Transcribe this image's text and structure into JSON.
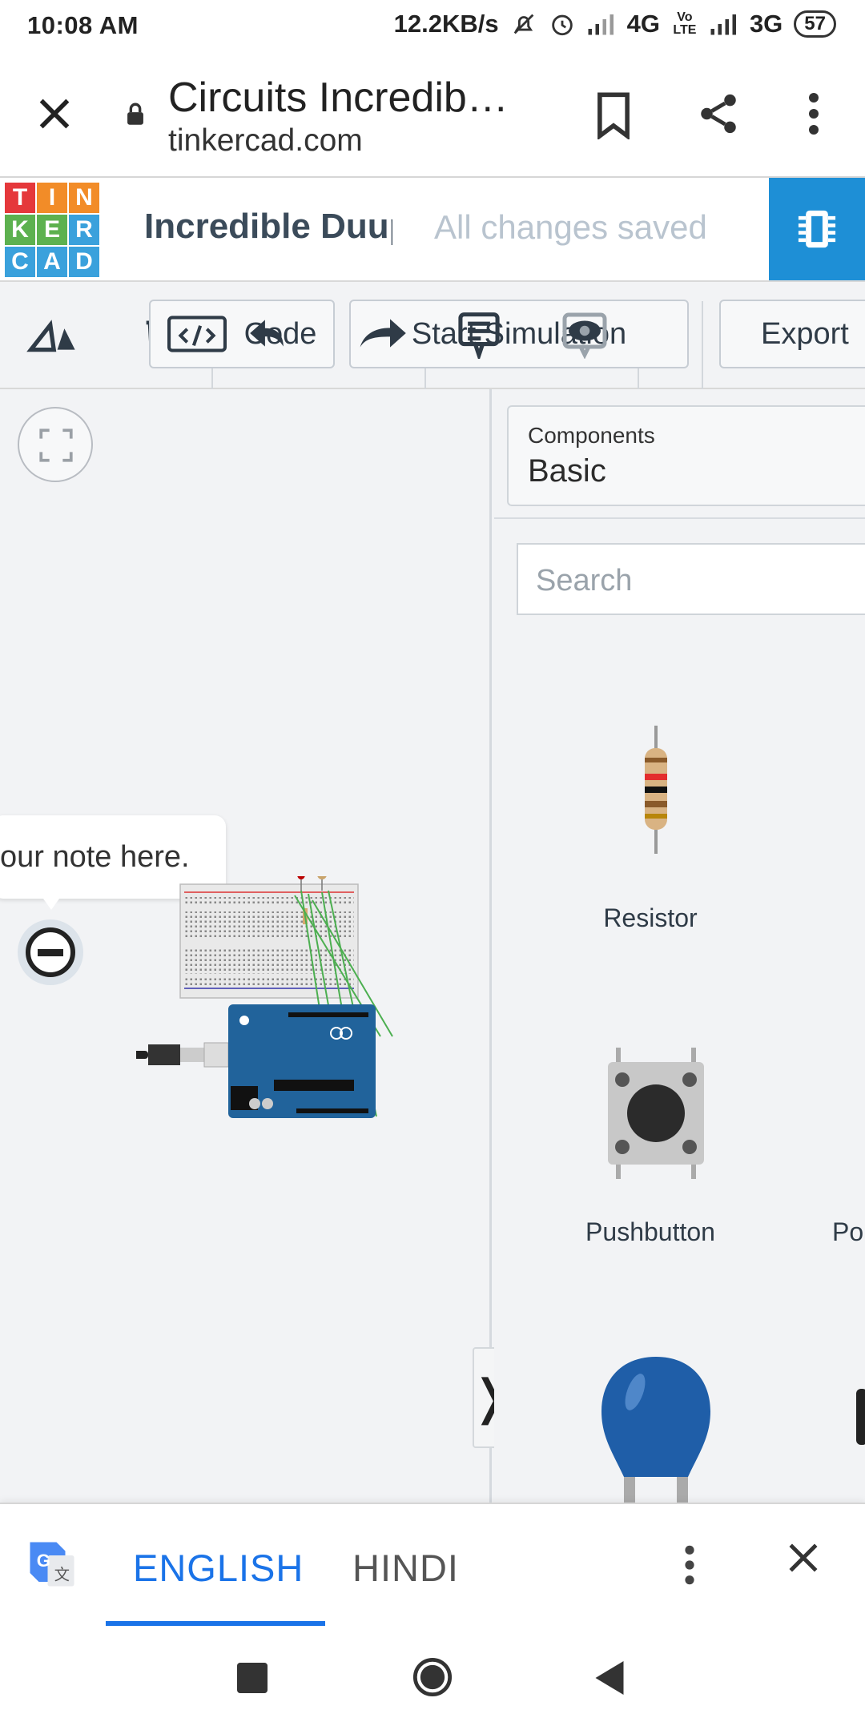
{
  "status_bar": {
    "time": "10:08 AM",
    "net_speed": "12.2KB/s",
    "network1": "4G",
    "volte": "Vo LTE",
    "network2": "3G",
    "battery": "57"
  },
  "browser": {
    "page_title": "Circuits Incredib…",
    "url": "tinkercad.com"
  },
  "tinkercad": {
    "logo_letters": [
      "T",
      "I",
      "N",
      "K",
      "E",
      "R",
      "C",
      "A",
      "D"
    ],
    "logo_colors": [
      "#e5383b",
      "#f28c28",
      "#f28c28",
      "#5db14f",
      "#5db14f",
      "#3aa1dc",
      "#3aa1dc",
      "#3aa1dc",
      "#3aa1dc"
    ],
    "project_name": "Incredible Duup",
    "save_status": "All changes saved",
    "accent": "#1e8fd6"
  },
  "toolbar": {
    "code_label": "Code",
    "simulation_label": "Start Simulation",
    "export_label": "Export"
  },
  "canvas": {
    "note_text": "our note here."
  },
  "panel": {
    "components_label": "Components",
    "components_value": "Basic",
    "search_placeholder": "Search",
    "items": [
      {
        "label": "Resistor"
      },
      {
        "label": "Pushbutton"
      },
      {
        "label": "Po"
      }
    ]
  },
  "translate_bar": {
    "lang1": "ENGLISH",
    "lang2": "HINDI",
    "accent": "#1a73e8"
  }
}
